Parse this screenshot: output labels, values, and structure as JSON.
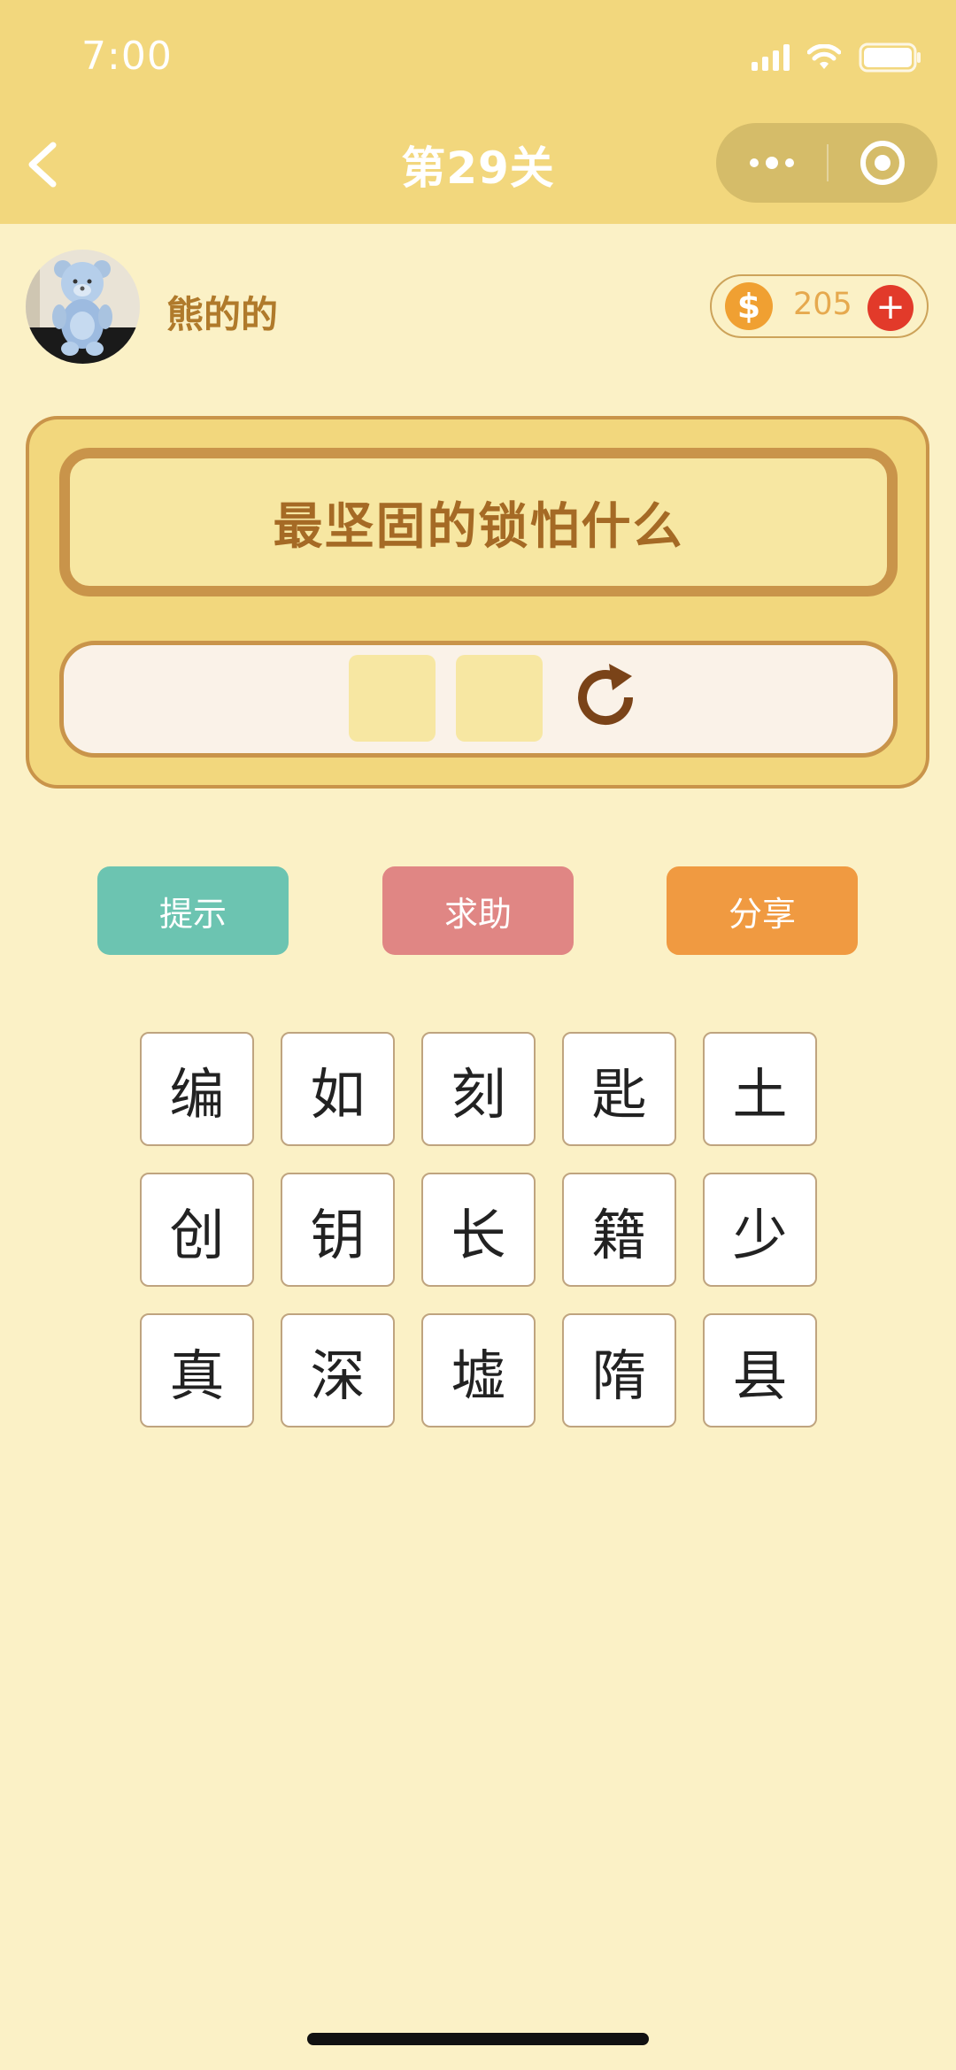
{
  "status_bar": {
    "time": "7:00"
  },
  "nav": {
    "title": "第29关"
  },
  "user": {
    "name": "熊的的"
  },
  "coins": {
    "count": "205",
    "add_symbol": "+",
    "coin_symbol": "$"
  },
  "puzzle": {
    "question": "最坚固的锁怕什么",
    "answer_slots": [
      "",
      ""
    ]
  },
  "actions": {
    "hint": "提示",
    "help": "求助",
    "share": "分享"
  },
  "characters": [
    [
      "编",
      "如",
      "刻",
      "匙",
      "土"
    ],
    [
      "创",
      "钥",
      "长",
      "籍",
      "少"
    ],
    [
      "真",
      "深",
      "墟",
      "隋",
      "县"
    ]
  ],
  "colors": {
    "header": "#F2D77D",
    "background": "#FBF1C6",
    "hint_button": "#6CC4B1",
    "help_button": "#E08684",
    "share_button": "#F09A41",
    "accent_brown": "#C9944A"
  }
}
